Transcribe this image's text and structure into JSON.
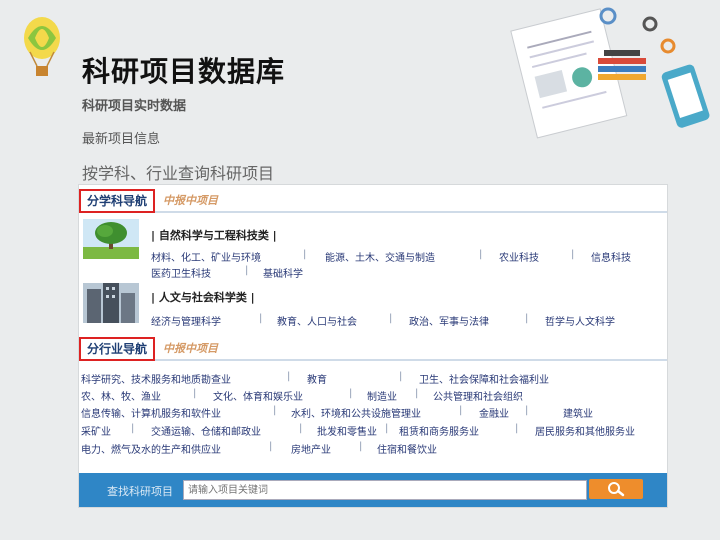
{
  "header": {
    "title": "科研项目数据库",
    "subtitle": "科研项目实时数据",
    "latest": "最新项目信息",
    "query": "按学科、行业查询科研项目"
  },
  "subject_nav": {
    "tab_active": "分学科导航",
    "tab_inactive": "中报中项目",
    "categories": [
      {
        "title": "| 自然科学与工程科技类 |",
        "links": [
          "材料、化工、矿业与环境",
          "能源、土木、交通与制造",
          "农业科技",
          "信息科技",
          "医药卫生科技",
          "基础科学"
        ]
      },
      {
        "title": "| 人文与社会科学类 |",
        "links": [
          "经济与管理科学",
          "教育、人口与社会",
          "政治、军事与法律",
          "哲学与人文科学"
        ]
      }
    ]
  },
  "industry_nav": {
    "tab_active": "分行业导航",
    "tab_inactive": "中报中项目",
    "links": [
      "科学研究、技术服务和地质勘查业",
      "教育",
      "卫生、社会保障和社会福利业",
      "农、林、牧、渔业",
      "文化、体育和娱乐业",
      "制造业",
      "公共管理和社会组织",
      "信息传输、计算机服务和软件业",
      "水利、环境和公共设施管理业",
      "金融业",
      "建筑业",
      "采矿业",
      "交通运输、仓储和邮政业",
      "批发和零售业",
      "租赁和商务服务业",
      "居民服务和其他服务业",
      "电力、燃气及水的生产和供应业",
      "房地产业",
      "住宿和餐饮业"
    ]
  },
  "search": {
    "label": "查找科研项目",
    "placeholder": "请输入项目关键词",
    "button_icon": "magnifier-icon"
  },
  "colors": {
    "search_bar": "#2f86c6",
    "search_button": "#ee8d2c",
    "highlight_box": "#dd2222",
    "link": "#2a3a77"
  }
}
